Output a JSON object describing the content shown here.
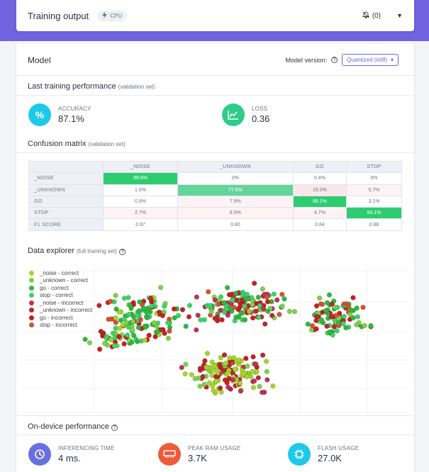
{
  "header": {
    "title": "Training output",
    "badge": "CPU",
    "notifications": "(0)"
  },
  "model": {
    "title": "Model",
    "version_label": "Model version:",
    "version_value": "Quantized (int8)"
  },
  "last_training": {
    "title": "Last training performance",
    "subtitle": "(validation set)",
    "accuracy_label": "ACCURACY",
    "accuracy_value": "87.1%",
    "loss_label": "LOSS",
    "loss_value": "0.36"
  },
  "confusion": {
    "title": "Confusion matrix",
    "subtitle": "(validation set)",
    "columns": [
      "_NOISE",
      "_UNKNOWN",
      "GO",
      "STOP"
    ],
    "rows": [
      {
        "label": "_NOISE",
        "cells": [
          "99.6%",
          "0%",
          "0.4%",
          "0%"
        ]
      },
      {
        "label": "_UNKNOWN",
        "cells": [
          "1.6%",
          "77.6%",
          "15.0%",
          "5.7%"
        ]
      },
      {
        "label": "GO",
        "cells": [
          "0.9%",
          "7.9%",
          "88.1%",
          "3.1%"
        ]
      },
      {
        "label": "STOP",
        "cells": [
          "2.7%",
          "8.5%",
          "4.7%",
          "84.1%"
        ]
      },
      {
        "label": "F1 SCORE",
        "cells": [
          "0.97",
          "0.80",
          "0.84",
          "0.88"
        ]
      }
    ]
  },
  "explorer": {
    "title": "Data explorer",
    "subtitle": "(full training set)",
    "legend": [
      {
        "label": "_noise - correct",
        "color": "#a8d42a"
      },
      {
        "label": "_unknown - correct",
        "color": "#7fd04a"
      },
      {
        "label": "go - correct",
        "color": "#2db83d"
      },
      {
        "label": "stop - correct",
        "color": "#3ed26a"
      },
      {
        "label": "_noise - incorrect",
        "color": "#c0305a"
      },
      {
        "label": "_unknown - incorrect",
        "color": "#b8282e"
      },
      {
        "label": "go - incorrect",
        "color": "#c81e1e"
      },
      {
        "label": "stop - incorrect",
        "color": "#d5522e"
      }
    ]
  },
  "on_device": {
    "title": "On-device performance",
    "inferencing_label": "INFERENCING TIME",
    "inferencing_value": "4 ms.",
    "ram_label": "PEAK RAM USAGE",
    "ram_value": "3.7K",
    "flash_label": "FLASH USAGE",
    "flash_value": "27.0K"
  },
  "colors": {
    "accent": "#6f63e0",
    "accuracy_icon": "#1ec8e8",
    "loss_icon": "#2ecc8a",
    "inferencing_icon": "#6a6fe0",
    "ram_icon": "#f05a3a",
    "flash_icon": "#1ec8e8"
  }
}
